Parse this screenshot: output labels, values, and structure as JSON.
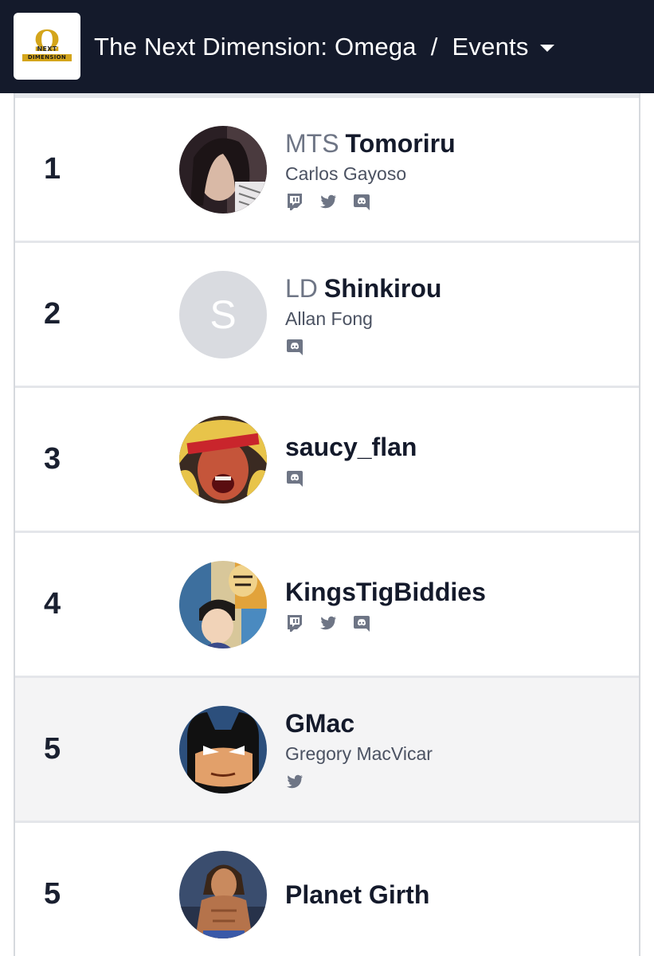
{
  "header": {
    "event_title": "The Next Dimension: Omega",
    "separator": "/",
    "section_label": "Events",
    "logo_text_top": "NEXT",
    "logo_text_bottom": "DIMENSION"
  },
  "colors": {
    "header_bg": "#141a2b",
    "logo_gold": "#d4a51b",
    "highlight_row": "#f4f4f5",
    "icon_gray": "#6e7585"
  },
  "standings": [
    {
      "rank": "1",
      "prefix": "MTS",
      "tag": "Tomoriru",
      "real_name": "Carlos Gayoso",
      "socials": [
        "twitch-icon",
        "twitter-icon",
        "discord-icon"
      ],
      "avatar_letter": ""
    },
    {
      "rank": "2",
      "prefix": "LD",
      "tag": "Shinkirou",
      "real_name": "Allan Fong",
      "socials": [
        "discord-icon"
      ],
      "avatar_letter": "S"
    },
    {
      "rank": "3",
      "prefix": "",
      "tag": "saucy_flan",
      "real_name": "",
      "socials": [
        "discord-icon"
      ],
      "avatar_letter": ""
    },
    {
      "rank": "4",
      "prefix": "",
      "tag": "KingsTigBiddies",
      "real_name": "",
      "socials": [
        "twitch-icon",
        "twitter-icon",
        "discord-icon"
      ],
      "avatar_letter": ""
    },
    {
      "rank": "5",
      "prefix": "",
      "tag": "GMac",
      "real_name": "Gregory MacVicar",
      "socials": [
        "twitter-icon"
      ],
      "avatar_letter": ""
    },
    {
      "rank": "5",
      "prefix": "",
      "tag": "Planet Girth",
      "real_name": "",
      "socials": [],
      "avatar_letter": ""
    }
  ]
}
